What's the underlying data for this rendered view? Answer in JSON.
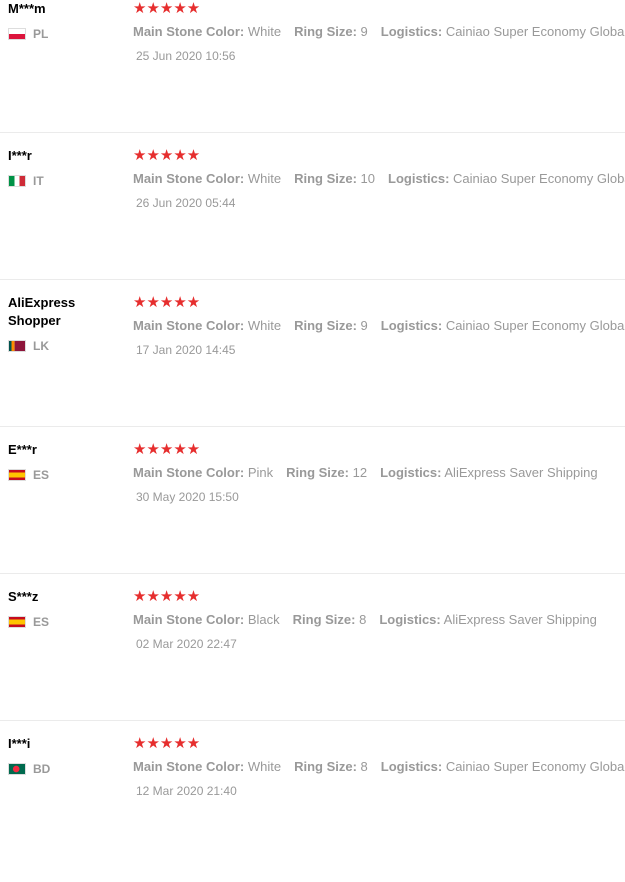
{
  "stars_glyph": "★★★★★",
  "labels": {
    "stone": "Main Stone Color:",
    "size": "Ring Size:",
    "logistics": "Logistics:"
  },
  "reviews": [
    {
      "user": "M***m",
      "country": "PL",
      "rating": 5,
      "stone": "White",
      "size": "9",
      "logistics": "Cainiao Super Economy Global",
      "date": "25 Jun 2020 10:56"
    },
    {
      "user": "I***r",
      "country": "IT",
      "rating": 5,
      "stone": "White",
      "size": "10",
      "logistics": "Cainiao Super Economy Global",
      "date": "26 Jun 2020 05:44"
    },
    {
      "user": "AliExpress Shopper",
      "country": "LK",
      "rating": 5,
      "stone": "White",
      "size": "9",
      "logistics": "Cainiao Super Economy Global",
      "date": "17 Jan 2020 14:45"
    },
    {
      "user": "E***r",
      "country": "ES",
      "rating": 5,
      "stone": "Pink",
      "size": "12",
      "logistics": "AliExpress Saver Shipping",
      "date": "30 May 2020 15:50"
    },
    {
      "user": "S***z",
      "country": "ES",
      "rating": 5,
      "stone": "Black",
      "size": "8",
      "logistics": "AliExpress Saver Shipping",
      "date": "02 Mar 2020 22:47"
    },
    {
      "user": "I***i",
      "country": "BD",
      "rating": 5,
      "stone": "White",
      "size": "8",
      "logistics": "Cainiao Super Economy Global",
      "date": "12 Mar 2020 21:40"
    }
  ]
}
